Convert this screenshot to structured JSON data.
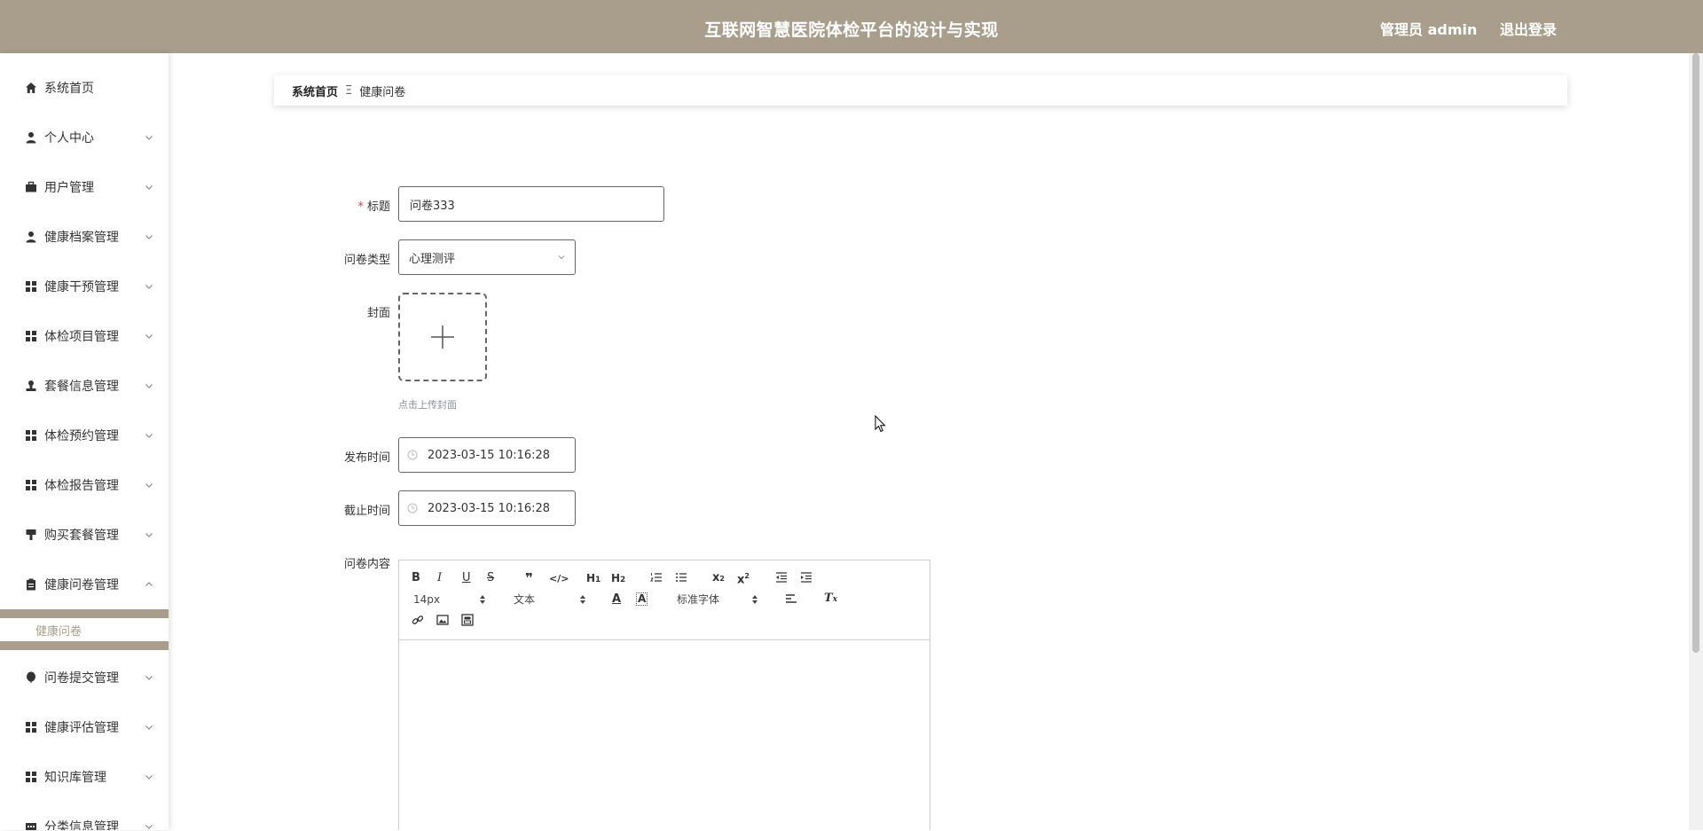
{
  "header": {
    "title": "互联网智慧医院体检平台的设计与实现",
    "user": "管理员 admin",
    "logout": "退出登录",
    "bg_color": "#a99d8b"
  },
  "sidebar": {
    "items": [
      {
        "label": "系统首页",
        "icon": "home-icon"
      },
      {
        "label": "个人中心",
        "icon": "user-icon"
      },
      {
        "label": "用户管理",
        "icon": "briefcase-icon"
      },
      {
        "label": "健康档案管理",
        "icon": "user-icon"
      },
      {
        "label": "健康干预管理",
        "icon": "grid-icon"
      },
      {
        "label": "体检项目管理",
        "icon": "grid-icon"
      },
      {
        "label": "套餐信息管理",
        "icon": "stamp-icon"
      },
      {
        "label": "体检预约管理",
        "icon": "grid-icon"
      },
      {
        "label": "体检报告管理",
        "icon": "grid-icon"
      },
      {
        "label": "购买套餐管理",
        "icon": "brush-icon"
      },
      {
        "label": "健康问卷管理",
        "icon": "clipboard-icon"
      },
      {
        "label": "问卷提交管理",
        "icon": "balloon-icon"
      },
      {
        "label": "健康评估管理",
        "icon": "grid-icon"
      },
      {
        "label": "知识库管理",
        "icon": "grid-icon"
      },
      {
        "label": "分类信息管理",
        "icon": "list-icon"
      }
    ],
    "submenu_active": "健康问卷"
  },
  "breadcrumb": {
    "home": "系统首页",
    "separator": "Ξ",
    "current": "健康问卷"
  },
  "form": {
    "title_label": "标题",
    "title_value": "问卷333",
    "type_label": "问卷类型",
    "type_value": "心理测评",
    "cover_label": "封面",
    "cover_hint": "点击上传封面",
    "publish_label": "发布时间",
    "publish_value": "2023-03-15 10:16:28",
    "deadline_label": "截止时间",
    "deadline_value": "2023-03-15 10:16:28",
    "content_label": "问卷内容"
  },
  "editor": {
    "font_size": "14px",
    "block_format": "文本",
    "font_family": "标准字体"
  }
}
